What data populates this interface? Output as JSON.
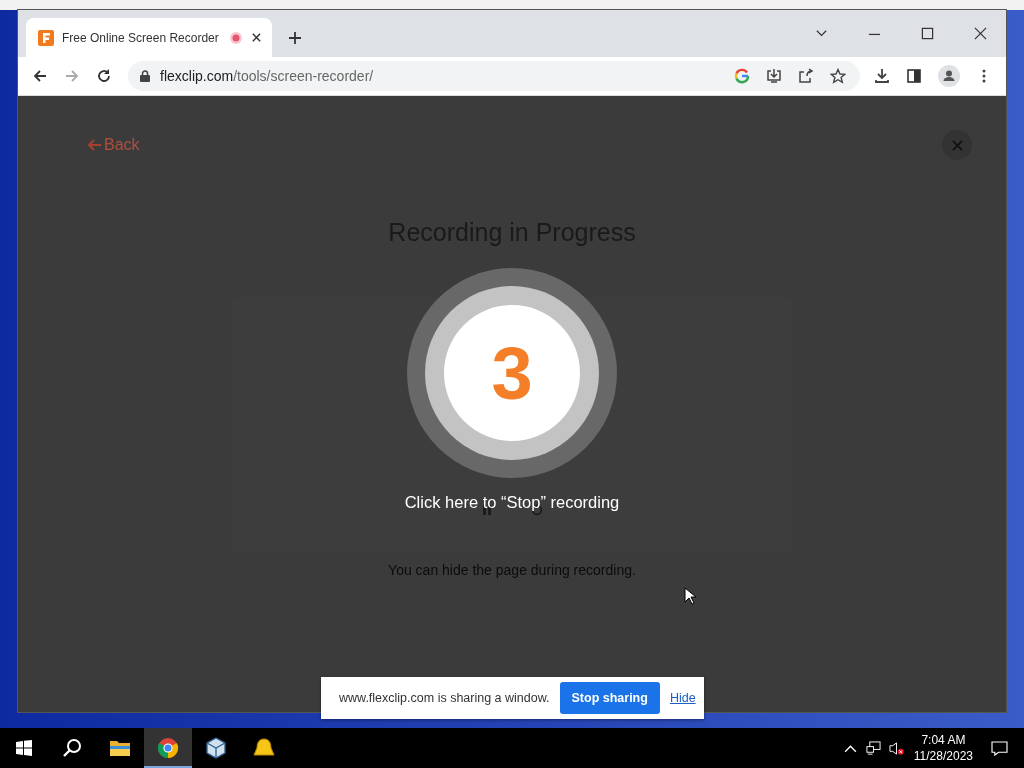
{
  "browser": {
    "tab": {
      "title": "Free Online Screen Recorder",
      "recording": true
    },
    "url_host": "flexclip.com",
    "url_path": "/tools/screen-recorder/"
  },
  "page": {
    "back": "Back",
    "title": "Recording in Progress",
    "countdown": "3",
    "stop_hint": "Click here to “Stop” recording",
    "note": "You can hide the page during recording."
  },
  "share_bar": {
    "message": "www.flexclip.com is sharing a window.",
    "stop": "Stop sharing",
    "hide": "Hide"
  },
  "taskbar": {
    "apps": [
      {
        "kind": "folder",
        "selected": false
      },
      {
        "kind": "chrome",
        "selected": true
      },
      {
        "kind": "box",
        "selected": false
      },
      {
        "kind": "bell",
        "selected": false
      }
    ],
    "time": "7:04 AM",
    "date": "11/28/2023"
  }
}
